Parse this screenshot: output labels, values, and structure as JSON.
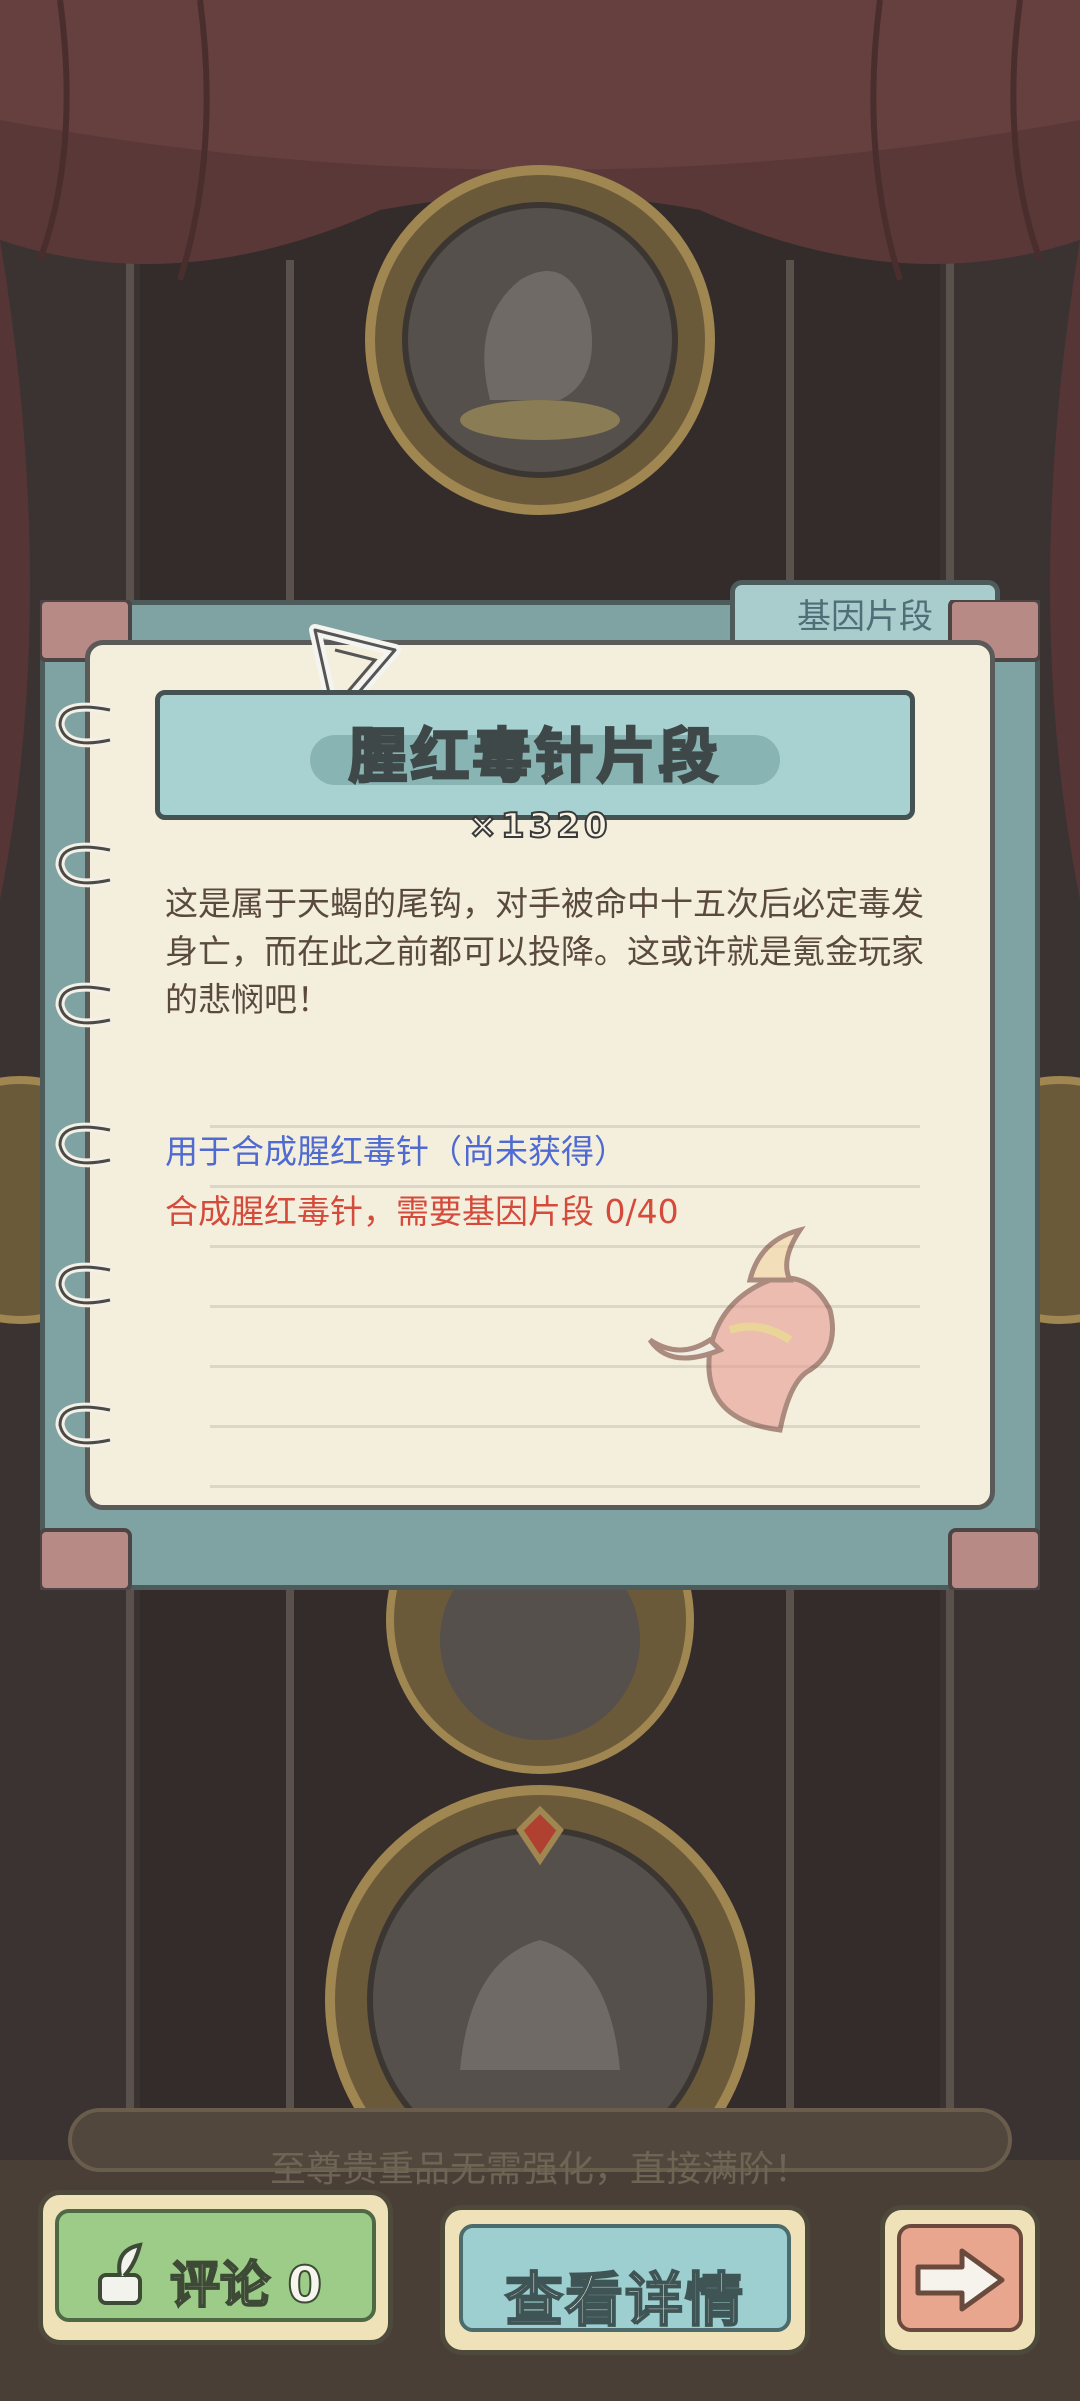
{
  "card": {
    "tab_label": "基因片段",
    "title": "腥红毒针片段",
    "count": "×1320",
    "description": "这是属于天蝎的尾钩，对手被命中十五次后必定毒发身亡，而在此之前都可以投降。这或许就是氪金玩家的悲悯吧！",
    "use_line": "用于合成腥红毒针（尚未获得）",
    "need_line": "合成腥红毒针，需要基因片段  0/40",
    "colors": {
      "use_line": "#4f6ad0",
      "need_line": "#d44b3c"
    }
  },
  "footer": {
    "notice": "至尊贵重品无需强化，直接满阶！",
    "comment_label": "评论 0",
    "detail_label": "查看详情",
    "next_icon": "arrow-right-icon"
  }
}
